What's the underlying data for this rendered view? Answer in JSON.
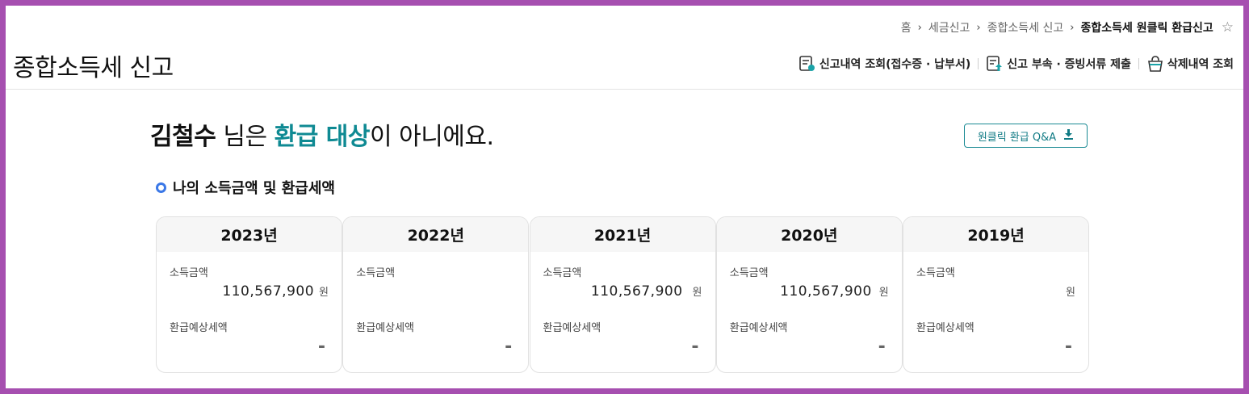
{
  "breadcrumb": {
    "items": [
      "홈",
      "세금신고",
      "종합소득세 신고"
    ],
    "current": "종합소득세 원클릭 환급신고"
  },
  "header": {
    "title": "종합소득세 신고",
    "actions": [
      {
        "label": "신고내역 조회(접수증 · 납부서)",
        "icon": "document-search-icon"
      },
      {
        "label": "신고 부속 · 증빙서류 제출",
        "icon": "document-upload-icon"
      },
      {
        "label": "삭제내역 조회",
        "icon": "trash-basket-icon"
      }
    ]
  },
  "headline": {
    "name": "김철수",
    "part1": " 님은 ",
    "highlight": "환급 대상",
    "part2": "이 아니에요."
  },
  "qa_button": {
    "label": "원클릭 환급 Q&A",
    "icon": "download-icon"
  },
  "section": {
    "title": "나의 소득금액 및 환급세액"
  },
  "labels": {
    "income": "소득금액",
    "refund": "환급예상세액",
    "unit": "원",
    "dash": "-"
  },
  "years": [
    {
      "year": "2023년",
      "income": "110,567,900",
      "show_unit": true
    },
    {
      "year": "2022년",
      "income": "",
      "show_unit": false
    },
    {
      "year": "2021년",
      "income": "110,567,900",
      "show_unit": true
    },
    {
      "year": "2020년",
      "income": "110,567,900",
      "show_unit": true
    },
    {
      "year": "2019년",
      "income": "",
      "show_unit": true
    }
  ],
  "colors": {
    "accent": "#0f8a93",
    "bullet": "#3b78e7",
    "frame": "#a64fb0"
  }
}
